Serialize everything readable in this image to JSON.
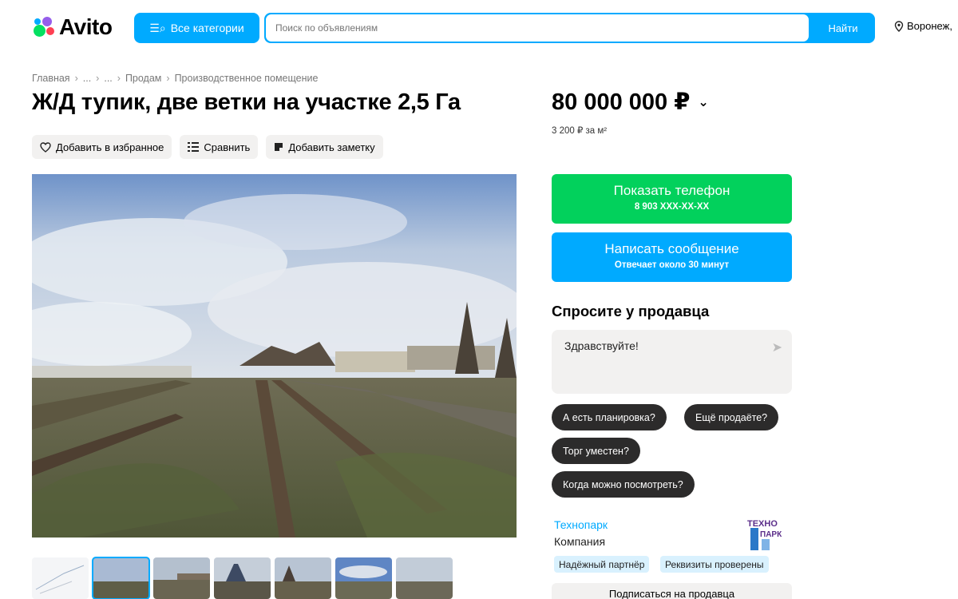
{
  "header": {
    "logo_text": "Avito",
    "categories_label": "Все категории",
    "search_placeholder": "Поиск по объявлениям",
    "search_button": "Найти",
    "location": "Воронеж,"
  },
  "breadcrumb": [
    "Главная",
    "...",
    "...",
    "Продам",
    "Производственное помещение"
  ],
  "title": "Ж/Д тупик, две ветки на участке 2,5 Га",
  "actions": {
    "favorite": "Добавить в избранное",
    "compare": "Сравнить",
    "note": "Добавить заметку"
  },
  "price": {
    "value": "80 000 000 ₽",
    "per_m2": "3 200 ₽ за м²"
  },
  "phone_button": {
    "label": "Показать телефон",
    "number": "8 903 XXX-XX-XX"
  },
  "message_button": {
    "label": "Написать сообщение",
    "sub": "Отвечает около 30 минут"
  },
  "ask": {
    "title": "Спросите у продавца",
    "message": "Здравствуйте!",
    "chips": [
      "А есть планировка?",
      "Ещё продаёте?",
      "Торг уместен?",
      "Когда можно посмотреть?"
    ]
  },
  "seller": {
    "name": "Технопарк",
    "type": "Компания",
    "badges": [
      "Надёжный партнёр",
      "Реквизиты проверены"
    ],
    "subscribe": "Подписаться на продавца",
    "logo_line1": "ТЕХНО",
    "logo_line2": "ПАРК"
  },
  "thumbnails_count": 7,
  "colors": {
    "accent": "#00aaff",
    "green": "#02d15c",
    "chip": "#2c2b2b"
  }
}
